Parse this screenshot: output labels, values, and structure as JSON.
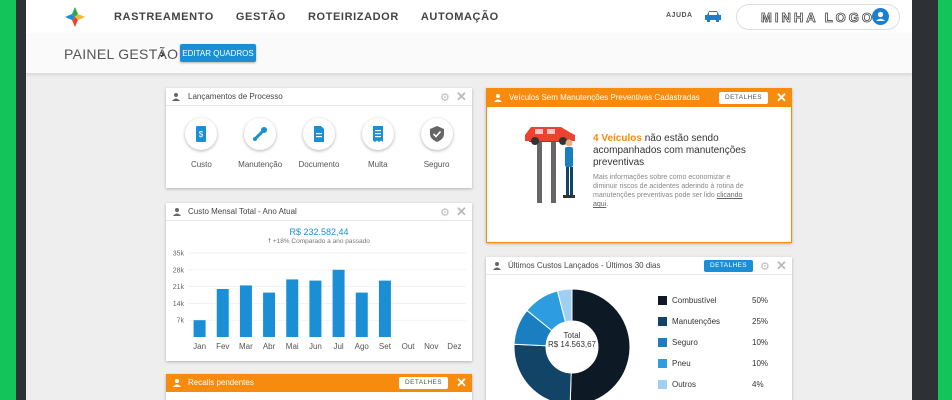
{
  "nav": {
    "links": [
      "RASTREAMENTO",
      "GESTÃO",
      "ROTEIRIZADOR",
      "AUTOMAÇÃO"
    ],
    "help": "AJUDA",
    "brand": "MINHA LOGO"
  },
  "header": {
    "title": "PAINEL GESTÃO",
    "edit_button": "EDITAR QUADROS"
  },
  "launch_card": {
    "title": "Lançamentos de Processo",
    "items": [
      {
        "label": "Custo",
        "icon": "cost-icon"
      },
      {
        "label": "Manutenção",
        "icon": "wrench-icon"
      },
      {
        "label": "Documento",
        "icon": "document-icon"
      },
      {
        "label": "Multa",
        "icon": "receipt-icon"
      },
      {
        "label": "Seguro",
        "icon": "shield-icon"
      }
    ]
  },
  "cost_card": {
    "title": "Custo Mensal Total - Ano Atual",
    "total": "R$ 232.582,44",
    "comparison": "+18% Comparado a ano passado"
  },
  "chart_data": {
    "type": "bar",
    "categories": [
      "Jan",
      "Fev",
      "Mar",
      "Abr",
      "Mai",
      "Jun",
      "Jul",
      "Ago",
      "Set",
      "Out",
      "Nov",
      "Dez"
    ],
    "values": [
      7000,
      20000,
      21500,
      18500,
      24000,
      23500,
      28000,
      18500,
      23500,
      0,
      0,
      0
    ],
    "yticks": [
      "7k",
      "14k",
      "21k",
      "28k",
      "35k"
    ],
    "ylim": [
      0,
      35000
    ],
    "color": "#1a8fd6"
  },
  "vehicles_card": {
    "title": "Veículos Sem Manutenções Preventivas Cadastradas",
    "details": "DETALHES",
    "highlight": "4 Veículos",
    "message": " não estão sendo acompanhados com manutenções preventivas",
    "info": "Mais informações sobre como economizar e diminuir riscos de acidentes aderindo à rotina de manutenções preventivas pode ser lido ",
    "link": "clicando aqui",
    "info_end": "."
  },
  "recent_costs_card": {
    "title": "Últimos Custos Lançados - Últimos 30 dias",
    "details": "DETALHES",
    "total_label": "Total",
    "total_value": "R$ 14.563,67",
    "slices": [
      {
        "label": "Combustível",
        "pct": "50%",
        "value": 50,
        "color": "#0d1a26"
      },
      {
        "label": "Manutenções",
        "pct": "25%",
        "value": 25,
        "color": "#114466"
      },
      {
        "label": "Seguro",
        "pct": "10%",
        "value": 10,
        "color": "#1a7fc1"
      },
      {
        "label": "Pneu",
        "pct": "10%",
        "value": 10,
        "color": "#2e9de0"
      },
      {
        "label": "Outros",
        "pct": "4%",
        "value": 4,
        "color": "#9fd0f2"
      }
    ]
  },
  "recalls_card": {
    "title": "Recalls pendentes",
    "details": "DETALHES"
  }
}
